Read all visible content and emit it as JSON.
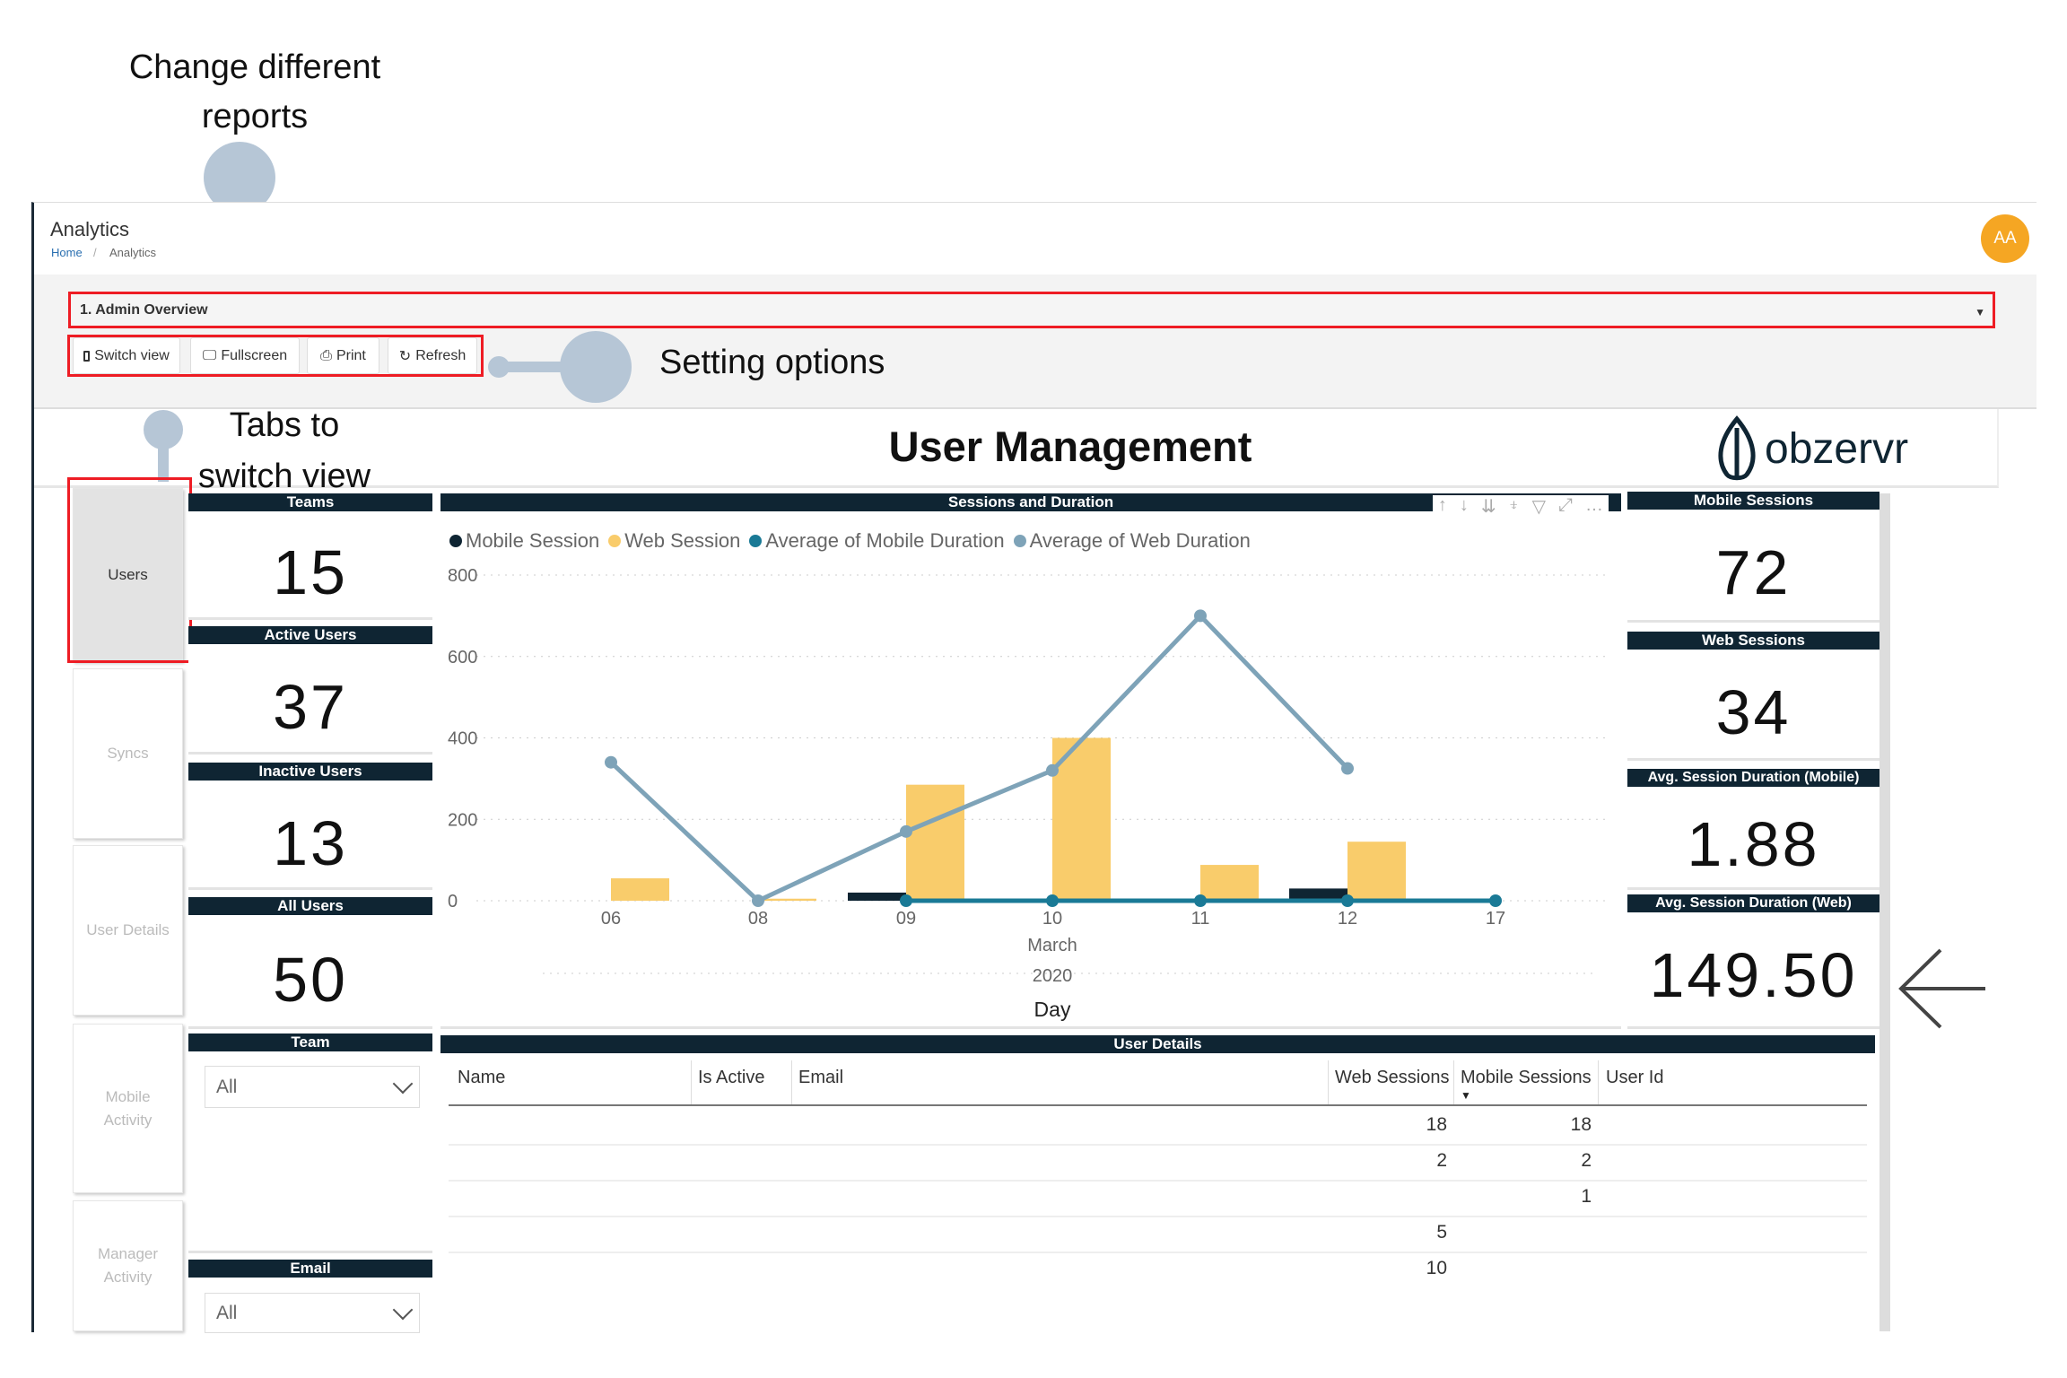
{
  "annotations": {
    "reports_line1": "Change different",
    "reports_line2": "reports",
    "settings": "Setting options",
    "tabs_line1": "Tabs to",
    "tabs_line2": "switch view"
  },
  "header": {
    "title": "Analytics",
    "breadcrumb": [
      "Home",
      "Analytics"
    ],
    "avatar": "AA",
    "avatar_color": "#f5a623"
  },
  "report_select": {
    "value": "1. Admin Overview"
  },
  "toolbar": {
    "switch_view": "Switch view",
    "fullscreen": "Fullscreen",
    "print": "Print",
    "refresh": "Refresh"
  },
  "report": {
    "title": "User Management",
    "logo": "obzervr"
  },
  "tabs": [
    {
      "label": "Users",
      "active": true
    },
    {
      "label": "Syncs"
    },
    {
      "label": "User Details"
    },
    {
      "label": "Mobile Activity"
    },
    {
      "label": "Manager Activity"
    }
  ],
  "cards": {
    "teams": {
      "label": "Teams",
      "value": "15"
    },
    "active_users": {
      "label": "Active Users",
      "value": "37"
    },
    "inactive_users": {
      "label": "Inactive Users",
      "value": "13"
    },
    "all_users": {
      "label": "All Users",
      "value": "50"
    },
    "mobile_sessions": {
      "label": "Mobile Sessions",
      "value": "72"
    },
    "web_sessions": {
      "label": "Web Sessions",
      "value": "34"
    },
    "avg_mobile": {
      "label": "Avg. Session Duration (Mobile)",
      "value": "1.88"
    },
    "avg_web": {
      "label": "Avg. Session Duration (Web)",
      "value": "149.50"
    }
  },
  "filters": {
    "team": {
      "label": "Team",
      "value": "All"
    },
    "email": {
      "label": "Email",
      "value": "All"
    }
  },
  "chart_data": {
    "type": "bar",
    "title": "Sessions and Duration",
    "categories": [
      "06",
      "08",
      "09",
      "10",
      "11",
      "12",
      "17"
    ],
    "xlabel_month": "March",
    "xlabel_year": "2020",
    "xlabel": "Day",
    "ylim": [
      0,
      800
    ],
    "yticks": [
      "0",
      "200",
      "400",
      "600",
      "800"
    ],
    "grid": true,
    "legend_position": "top-left",
    "series": [
      {
        "name": "Mobile Session",
        "kind": "bar",
        "color": "#0f2533",
        "values": [
          0,
          0,
          20,
          0,
          5,
          30,
          null
        ]
      },
      {
        "name": "Web Session",
        "kind": "bar",
        "color": "#f9cc6b",
        "values": [
          55,
          5,
          285,
          400,
          88,
          145,
          null
        ]
      },
      {
        "name": "Average of Mobile Duration",
        "kind": "line",
        "color": "#1a7a96",
        "values": [
          null,
          null,
          0,
          0,
          0,
          0,
          0
        ]
      },
      {
        "name": "Average of Web Duration",
        "kind": "line",
        "color": "#7ea3b8",
        "values": [
          340,
          0,
          170,
          320,
          700,
          325,
          null
        ]
      }
    ]
  },
  "user_details": {
    "title": "User Details",
    "columns": [
      "Name",
      "Is Active",
      "Email",
      "Web Sessions",
      "Mobile Sessions",
      "User Id"
    ],
    "rows": [
      {
        "web": "18",
        "mobile": "18"
      },
      {
        "web": "2",
        "mobile": "2"
      },
      {
        "web": "",
        "mobile": "1"
      },
      {
        "web": "5",
        "mobile": ""
      },
      {
        "web": "10",
        "mobile": ""
      }
    ]
  }
}
